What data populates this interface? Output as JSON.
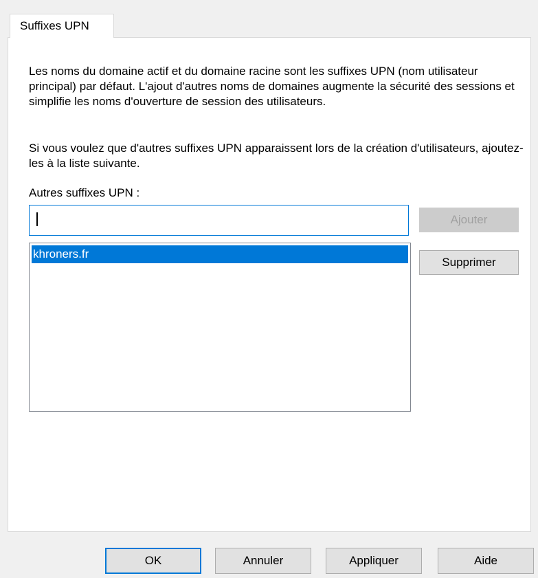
{
  "tab": {
    "label": "Suffixes UPN"
  },
  "description": {
    "paragraph1": "Les noms du domaine actif et du domaine racine sont les suffixes UPN (nom utilisateur principal) par défaut. L'ajout d'autres noms de domaines augmente la sécurité des sessions et simplifie les noms d'ouverture de session des utilisateurs.",
    "paragraph2": "Si vous voulez que d'autres suffixes UPN apparaissent lors de la création d'utilisateurs, ajoutez-les à la liste suivante."
  },
  "suffix_field": {
    "label": "Autres suffixes UPN :",
    "value": ""
  },
  "suffix_list": {
    "items": [
      "khroners.fr"
    ],
    "selected_index": 0
  },
  "side_buttons": {
    "add_label": "Ajouter",
    "remove_label": "Supprimer"
  },
  "dialog_buttons": {
    "ok_label": "OK",
    "cancel_label": "Annuler",
    "apply_label": "Appliquer",
    "help_label": "Aide"
  },
  "colors": {
    "accent": "#0078d7",
    "background": "#f0f0f0",
    "disabled_button": "#cccccc"
  }
}
